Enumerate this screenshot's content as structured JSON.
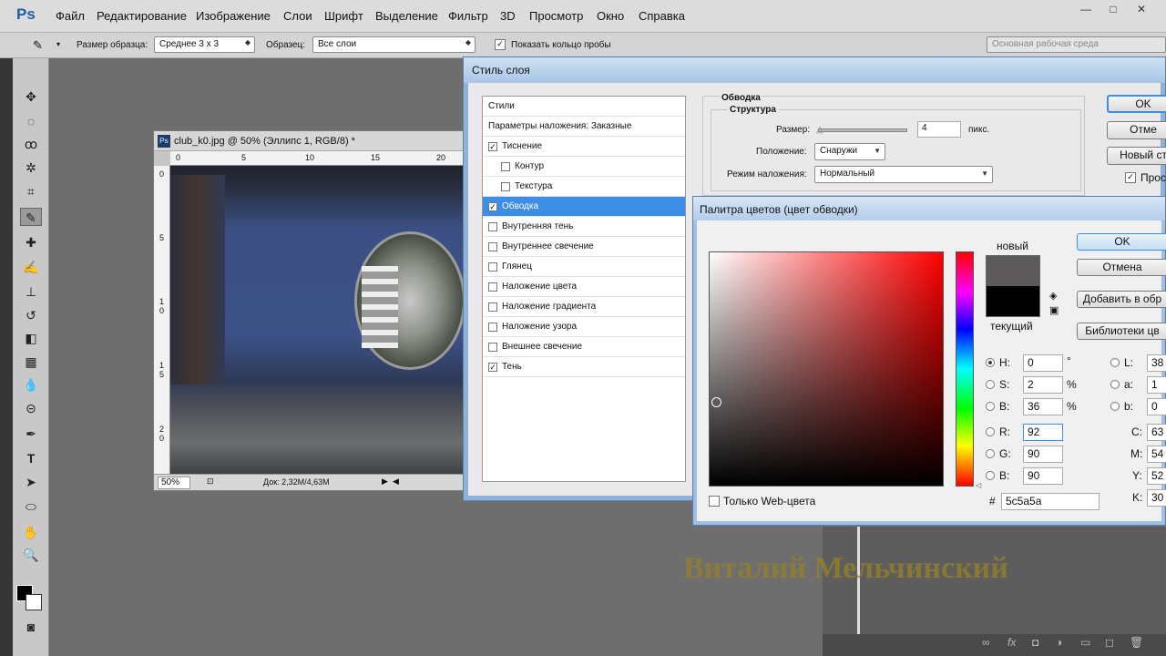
{
  "menubar": {
    "logo": "Ps",
    "items": [
      "Файл",
      "Редактирование",
      "Изображение",
      "Слои",
      "Шрифт",
      "Выделение",
      "Фильтр",
      "3D",
      "Просмотр",
      "Окно",
      "Справка"
    ],
    "window_buttons": [
      "—",
      "□",
      "✕"
    ]
  },
  "options": {
    "sample_size_label": "Размер образца:",
    "sample_size_value": "Среднее 3 х 3",
    "sample_label": "Образец:",
    "sample_value": "Все слои",
    "show_ring_label": "Показать кольцо пробы",
    "workspace": "Основная рабочая среда"
  },
  "document": {
    "title": "club_k0.jpg @ 50% (Эллипс 1, RGB/8) *",
    "ps_badge": "Ps",
    "ruler_h": [
      "0",
      "5",
      "10",
      "15",
      "20"
    ],
    "ruler_v": [
      "0",
      "5",
      "1",
      "0",
      "1",
      "5",
      "2",
      "0"
    ],
    "zoom": "50%",
    "doc_info": "Док: 2,32M/4,63M"
  },
  "layer_style": {
    "title": "Стиль слоя",
    "styles_header": "Стили",
    "blend_options": "Параметры наложения: Заказные",
    "items": [
      {
        "label": "Тиснение",
        "checked": "✓"
      },
      {
        "label": "Контур",
        "checked": ""
      },
      {
        "label": "Текстура",
        "checked": ""
      },
      {
        "label": "Обводка",
        "checked": "✓"
      },
      {
        "label": "Внутренняя тень",
        "checked": ""
      },
      {
        "label": "Внутреннее свечение",
        "checked": ""
      },
      {
        "label": "Глянец",
        "checked": ""
      },
      {
        "label": "Наложение цвета",
        "checked": ""
      },
      {
        "label": "Наложение градиента",
        "checked": ""
      },
      {
        "label": "Наложение узора",
        "checked": ""
      },
      {
        "label": "Внешнее свечение",
        "checked": ""
      },
      {
        "label": "Тень",
        "checked": "✓"
      }
    ],
    "section_title": "Обводка",
    "structure": "Структура",
    "size_label": "Размер:",
    "size_value": "4",
    "size_unit": "пикс.",
    "position_label": "Положение:",
    "position_value": "Снаружи",
    "blend_label": "Режим наложения:",
    "blend_value": "Нормальный",
    "ok": "OK",
    "cancel": "Отме",
    "new_style": "Новый ст",
    "preview": "Прос"
  },
  "color_picker": {
    "title": "Палитра цветов (цвет обводки)",
    "new_label": "новый",
    "current_label": "текущий",
    "new_color": "#5c5a5a",
    "current_color": "#000000",
    "ok": "OK",
    "cancel": "Отмена",
    "add_swatch": "Добавить в обр",
    "libraries": "Библиотеки цв",
    "web_only": "Только Web-цвета",
    "H": "0",
    "S": "2",
    "B": "36",
    "R": "92",
    "G": "90",
    "Bv": "90",
    "L": "38",
    "a": "1",
    "b": "0",
    "C": "63",
    "M": "54",
    "Y": "52",
    "K": "30",
    "deg": "°",
    "pct": "%",
    "hex_label": "#",
    "hex": "5c5a5a"
  },
  "watermark": "Виталий Мельчинский"
}
